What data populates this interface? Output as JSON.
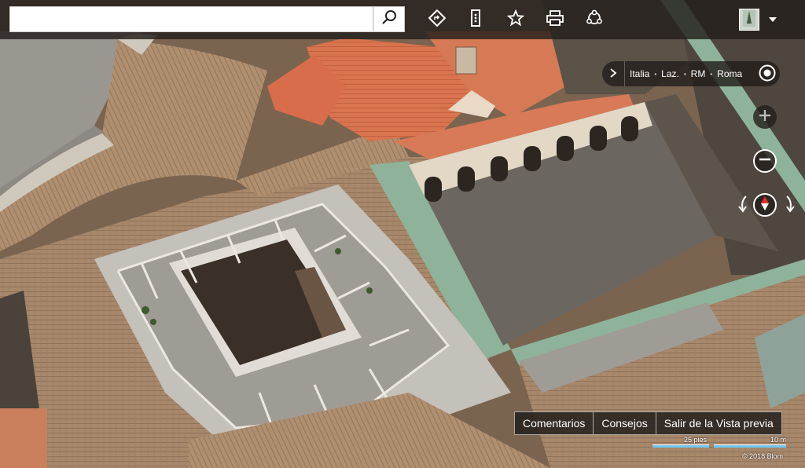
{
  "search": {
    "value": "",
    "placeholder": ""
  },
  "toolbar": {
    "icons": [
      "search-icon",
      "directions-icon",
      "list-icon",
      "star-icon",
      "print-icon",
      "share-icon"
    ],
    "avatar_icon": "user-avatar-icon",
    "caret_icon": "chevron-down-icon"
  },
  "breadcrumb": {
    "expand_icon": "chevron-right-icon",
    "items": [
      "Italia",
      "Laz.",
      "RM",
      "Roma"
    ],
    "separator": "•",
    "locate_icon": "locate-me-icon"
  },
  "map_controls": {
    "zoom_in_icon": "plus-icon",
    "zoom_out_icon": "minus-icon",
    "compass_icon": "compass-icon",
    "rotate_left_icon": "rotate-left-arrow-icon",
    "rotate_right_icon": "rotate-right-arrow-icon"
  },
  "bottom_bar": {
    "feedback": "Comentarios",
    "tips": "Consejos",
    "exit_preview": "Salir de la Vista previa"
  },
  "scale": {
    "imperial": "25 pies",
    "metric": "10 m"
  },
  "copyright": "© 2018 Blom",
  "colors": {
    "toolbar_bg": "#231e1c",
    "roof_tile": "#a8876a",
    "orange_roof": "#d8714f",
    "green_ridge": "#8fb39a",
    "courtyard": "#6e6760",
    "scale_bar": "#6ec6f0"
  }
}
